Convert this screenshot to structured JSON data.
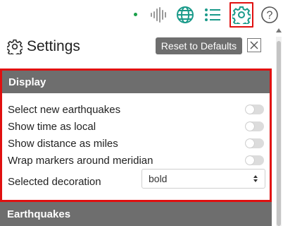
{
  "toolbar": {
    "icons": [
      "status-dot",
      "audio-waveform-icon",
      "globe-icon",
      "list-icon",
      "gear-icon",
      "help-icon"
    ],
    "accent_color": "#1a9a8a",
    "active_color": "#e01010"
  },
  "settings": {
    "title": "Settings",
    "reset_label": "Reset to Defaults",
    "close_label": "✕"
  },
  "display": {
    "header": "Display",
    "options": [
      {
        "label": "Select new earthquakes",
        "enabled": false
      },
      {
        "label": "Show time as local",
        "enabled": false
      },
      {
        "label": "Show distance as miles",
        "enabled": false
      },
      {
        "label": "Wrap markers around meridian",
        "enabled": false
      }
    ],
    "decoration_label": "Selected decoration",
    "decoration_value": "bold"
  },
  "earthquakes": {
    "header": "Earthquakes"
  }
}
